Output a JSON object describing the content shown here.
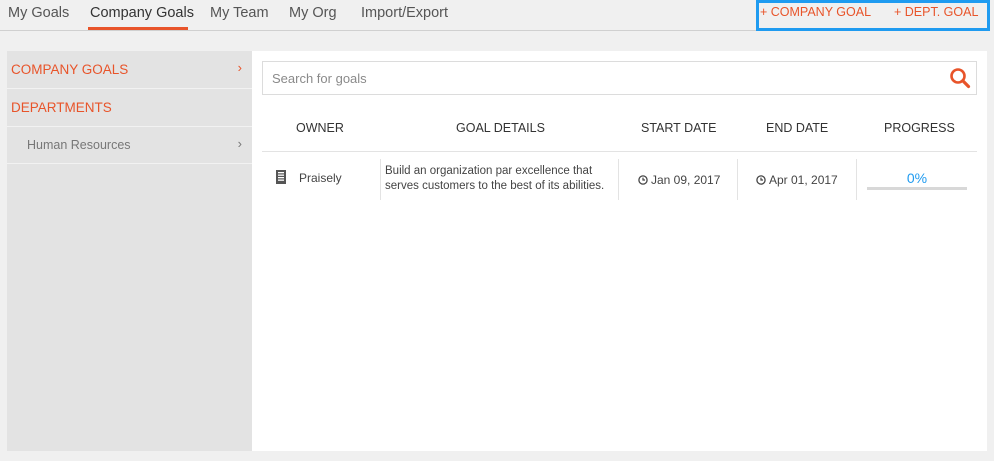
{
  "nav": {
    "tabs": [
      {
        "label": "My Goals"
      },
      {
        "label": "Company Goals"
      },
      {
        "label": "My Team"
      },
      {
        "label": "My Org"
      },
      {
        "label": "Import/Export"
      }
    ],
    "active_tab": "Company Goals"
  },
  "actions": {
    "company_goal": "+ COMPANY GOAL",
    "dept_goal": "+ DEPT. GOAL"
  },
  "sidebar": {
    "company_goals": "COMPANY GOALS",
    "departments": "DEPARTMENTS",
    "department_items": [
      {
        "label": "Human Resources"
      }
    ]
  },
  "search": {
    "placeholder": "Search for goals"
  },
  "table": {
    "headers": {
      "owner": "OWNER",
      "goal_details": "GOAL DETAILS",
      "start_date": "START DATE",
      "end_date": "END DATE",
      "progress": "PROGRESS"
    },
    "rows": [
      {
        "owner": "Praisely",
        "details": "Build an organization par excellence that serves customers to the best of its abilities.",
        "start_date": "Jan 09, 2017",
        "end_date": "Apr 01, 2017",
        "progress": "0%",
        "progress_fraction": 0
      }
    ]
  },
  "colors": {
    "accent": "#e8542a",
    "progress": "#1f9bf0",
    "highlight_box": "#1f9bf0"
  },
  "icons": {
    "owner": "building-icon",
    "date": "clock-icon",
    "search": "search-icon",
    "sidebar_arrow": "chevron-right-icon"
  }
}
